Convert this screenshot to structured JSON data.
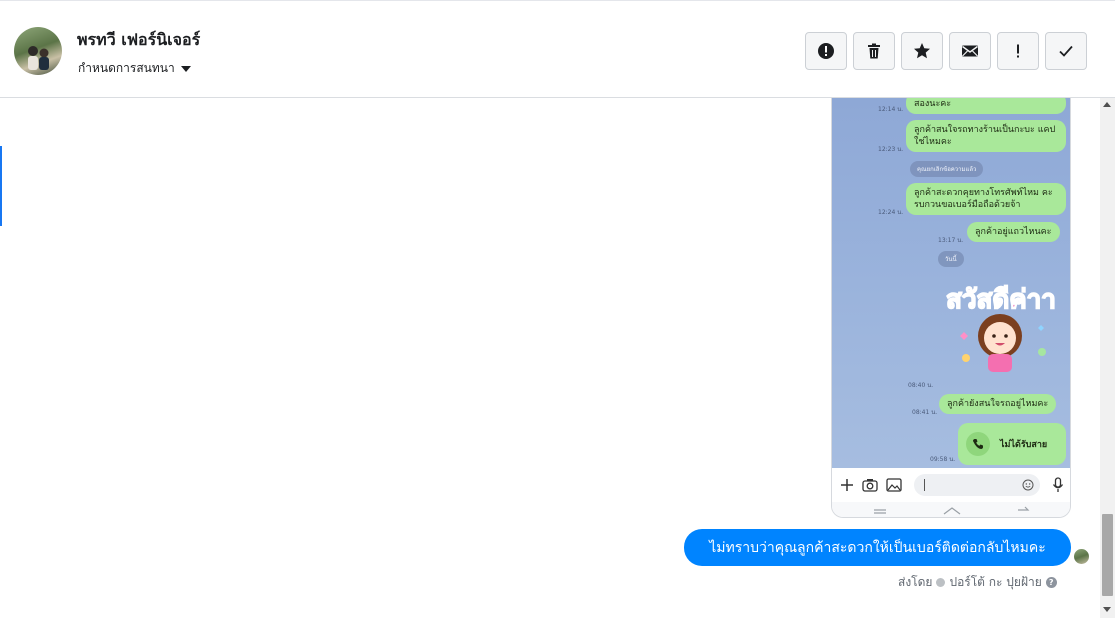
{
  "header": {
    "contact_name": "พรทวี เฟอร์นิเจอร์",
    "assign_label": "กำหนดการสนทนา"
  },
  "actions": [
    {
      "name": "alert-icon",
      "label": "Mark spam"
    },
    {
      "name": "trash-icon",
      "label": "Delete"
    },
    {
      "name": "star-icon",
      "label": "Star"
    },
    {
      "name": "envelope-icon",
      "label": "Mark unread"
    },
    {
      "name": "exclamation-icon",
      "label": "Follow up"
    },
    {
      "name": "check-icon",
      "label": "Done"
    }
  ],
  "screenshot": {
    "messages": [
      {
        "text": "สองนะคะ",
        "time": "12:14 น."
      },
      {
        "text": "ลูกค้าสนใจรถทางร้านเป็นกะบะ แคปใช่ไหมคะ",
        "time": "12:23 น."
      },
      {
        "system": "คุณยกเลิกข้อความแล้ว"
      },
      {
        "text": "ลูกค้าสะดวกคุยทางโทรศัพท์ไหม คะรบกวนขอเบอร์มือถือด้วยจ้า",
        "time": "12:24 น."
      },
      {
        "text": "ลูกค้าอยู่แถวไหนคะ",
        "time": "13:17 น."
      },
      {
        "system": "วันนี้"
      },
      {
        "sticker": "สวัสดีค่าา",
        "time": "08:40 น."
      },
      {
        "text": "ลูกค้ายังสนใจรถอยู่ไหมคะ",
        "time": "08:41 น."
      },
      {
        "call": "ไม่ได้รับสาย",
        "time": "09:58 น."
      }
    ]
  },
  "conversation": {
    "outgoing_message": "ไม่ทราบว่าคุณลูกค้าสะดวกให้เป็นเบอร์ติดต่อกลับไหมคะ",
    "sent_by_label": "ส่งโดย",
    "sender_name": "ปอร์โต้ กะ ปุยฝ้าย"
  },
  "colors": {
    "brand_blue": "#0084ff",
    "line_green": "#a9e89a",
    "line_bg": "#9ab3dc"
  }
}
